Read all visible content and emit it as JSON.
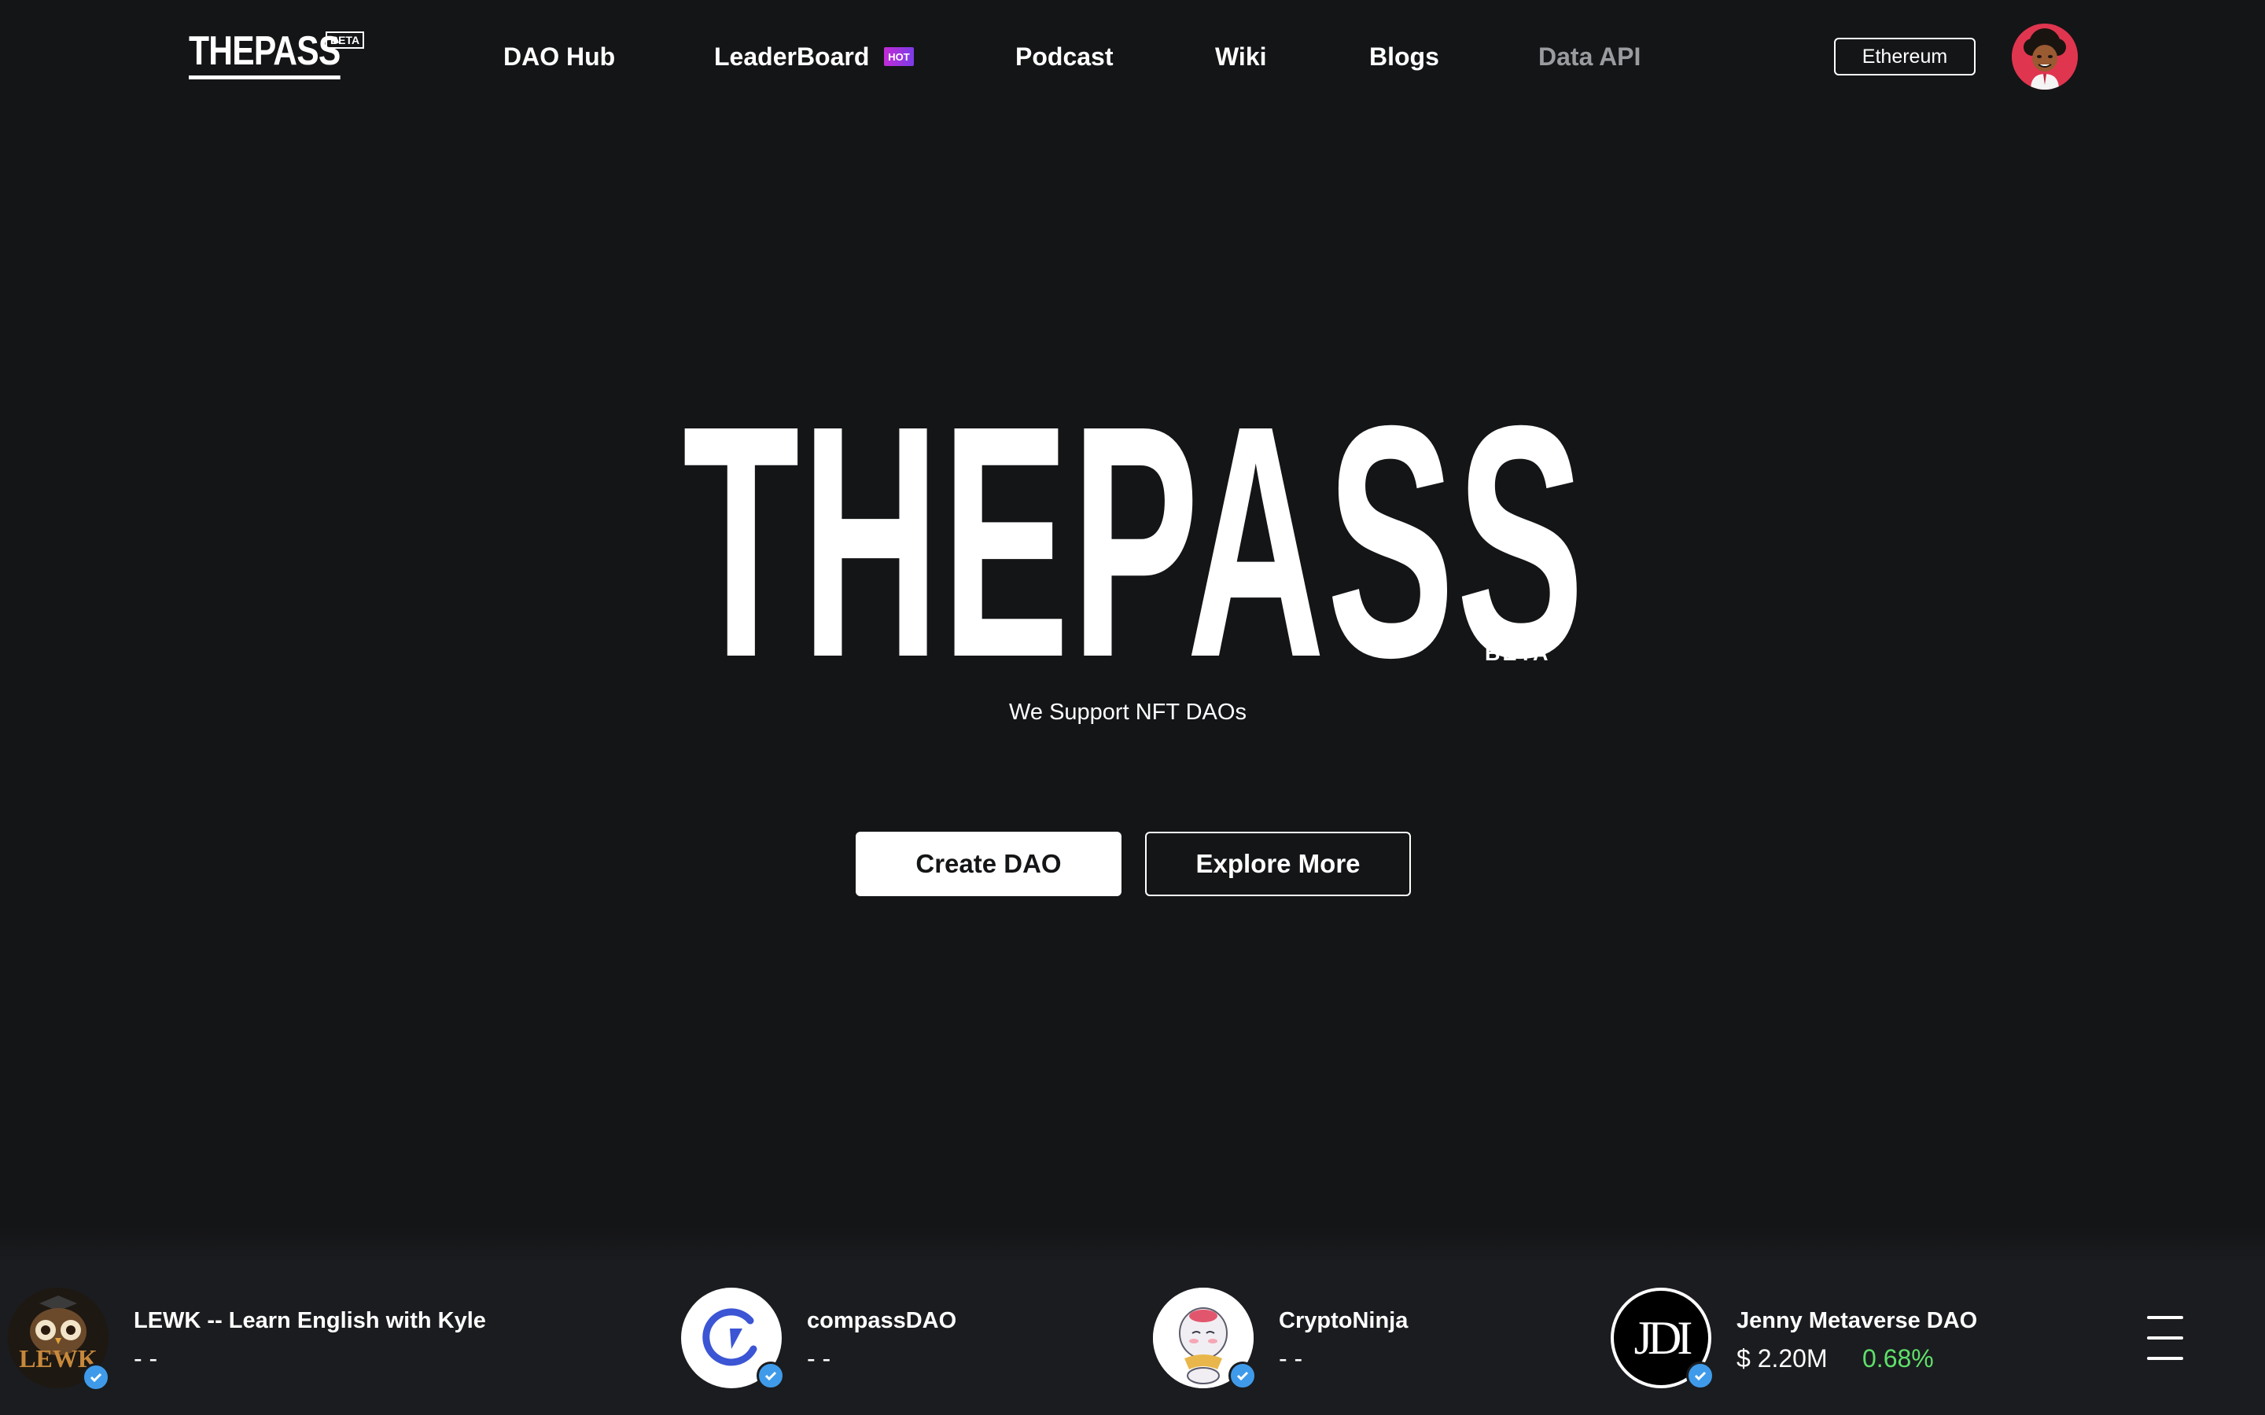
{
  "header": {
    "logo": "THEPASS",
    "logo_badge": "BETA",
    "nav": [
      {
        "label": "DAO Hub"
      },
      {
        "label": "LeaderBoard",
        "badge": "HOT"
      },
      {
        "label": "Podcast"
      },
      {
        "label": "Wiki"
      },
      {
        "label": "Blogs"
      },
      {
        "label": "Data API",
        "muted": true
      }
    ],
    "network": "Ethereum",
    "avatar_icon": "user-avatar-icon"
  },
  "hero": {
    "title": "THEPASS",
    "badge": "BETA",
    "tagline": "We Support NFT DAOs",
    "primary_button": "Create DAO",
    "secondary_button": "Explore More"
  },
  "ticker": {
    "items": [
      {
        "name": "LEWK -- Learn English with Kyle",
        "value": "- -",
        "change": "",
        "logo_text": "LEWK",
        "verified": true
      },
      {
        "name": "compassDAO",
        "value": "- -",
        "change": "",
        "verified": true
      },
      {
        "name": "CryptoNinja",
        "value": "- -",
        "change": "",
        "verified": true
      },
      {
        "name": "Jenny Metaverse DAO",
        "value": "$ 2.20M",
        "change": "0.68%",
        "logo_text": "JDI",
        "verified": true
      }
    ],
    "menu_icon": "hamburger-menu-icon"
  },
  "colors": {
    "background": "#141517",
    "ticker_background": "#1b1c1f",
    "positive": "#5ee06a",
    "verified": "#3f9bea",
    "hot_badge": "#c12bd6"
  }
}
